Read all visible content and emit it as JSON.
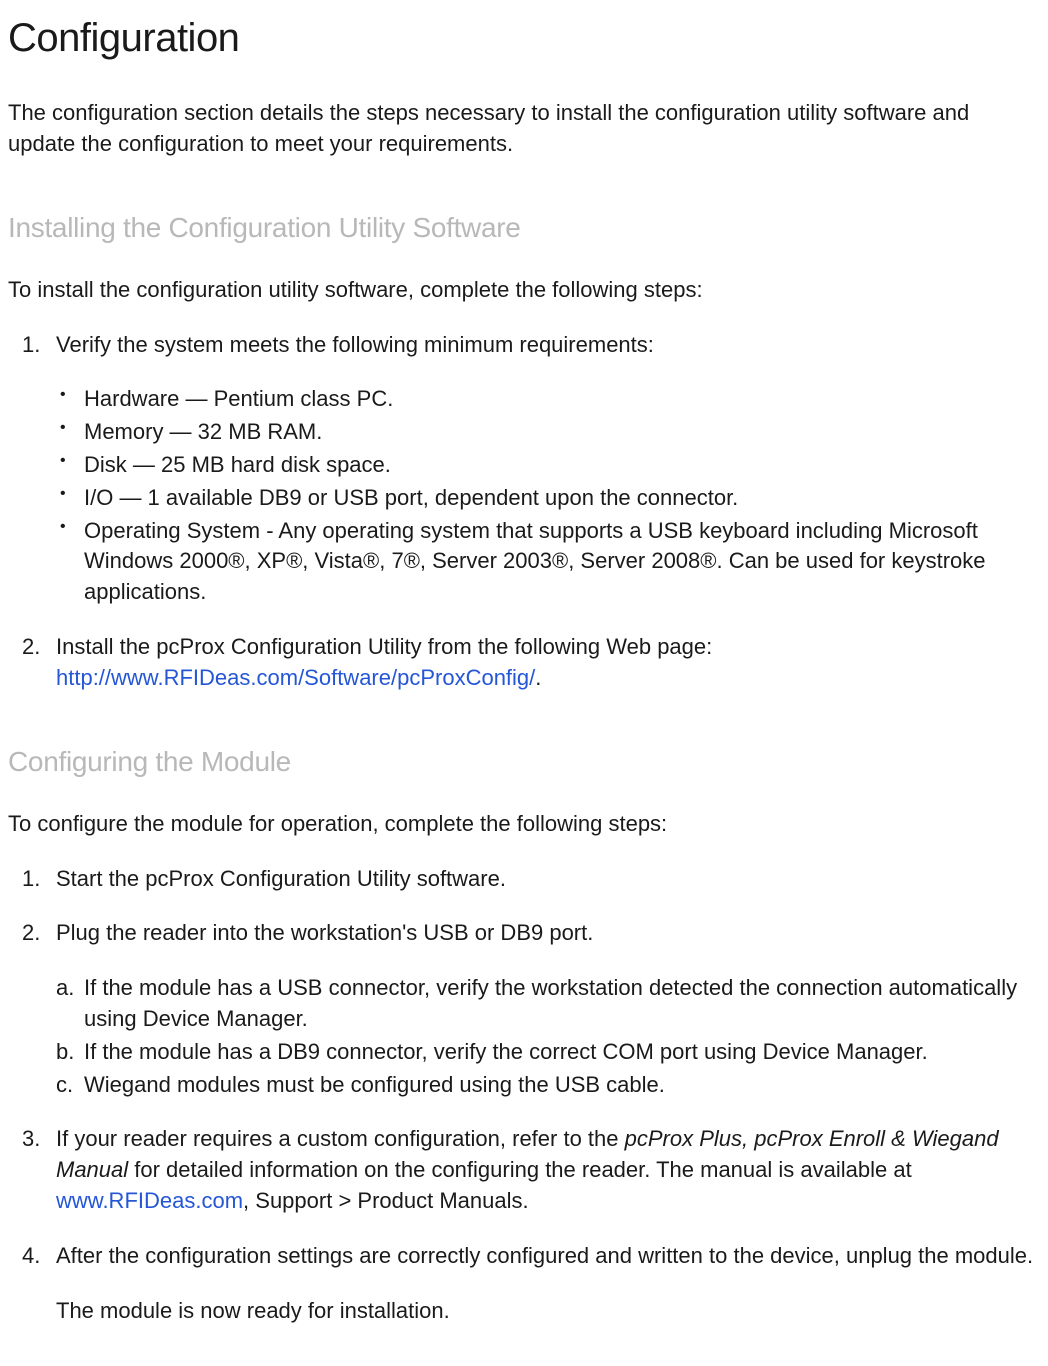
{
  "title": "Configuration",
  "intro": "The configuration section details the steps necessary to install the configuration utility software and update the configuration to meet your requirements.",
  "section1": {
    "heading": "Installing the Configuration Utility Software",
    "intro": "To install the configuration utility software, complete the following steps:",
    "step1": "Verify the system meets the following minimum requirements:",
    "bullets": {
      "b0": "Hardware — Pentium class PC.",
      "b1": "Memory — 32 MB RAM.",
      "b2": "Disk — 25 MB hard disk space.",
      "b3": "I/O — 1 available DB9 or USB port, dependent upon the connector.",
      "b4": "Operating System - Any operating system that supports a USB keyboard including Microsoft Windows 2000®, XP®, Vista®, 7®, Server 2003®, Server 2008®. Can be used for keystroke applications."
    },
    "step2_pre": "Install the pcProx Configuration Utility from the following Web page: ",
    "step2_link": "http://www.RFIDeas.com/Software/pcProxConfig/",
    "step2_post": "."
  },
  "section2": {
    "heading": "Configuring the Module",
    "intro": "To configure the module for operation, complete the following steps:",
    "step1": "Start the pcProx Configuration Utility software.",
    "step2": "Plug the reader into the workstation's USB or DB9 port.",
    "sub": {
      "a": "If the module has a USB connector, verify the workstation detected the connection automatically using Device Manager.",
      "b": "If the module has a DB9 connector, verify the correct COM port using Device Manager.",
      "c": "Wiegand modules must be configured using the USB cable."
    },
    "step3_pre": "If your reader requires a custom configuration, refer to the ",
    "step3_italic": "pcProx Plus, pcProx Enroll & Wiegand Manual",
    "step3_mid": " for detailed information on the configuring the reader. The manual is available at ",
    "step3_link": "www.RFIDeas.com",
    "step3_post": ",  Support  >  Product Manuals.",
    "step4": "After the configuration settings are correctly configured and written to the device, unplug the module.",
    "trailing": "The module is now ready for installation."
  }
}
